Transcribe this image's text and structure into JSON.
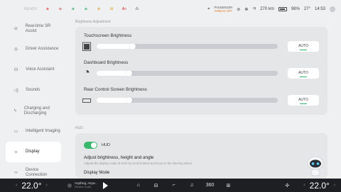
{
  "status": {
    "ready": "READY",
    "indicators": [
      {
        "name": "seatbelt-warning-icon",
        "text": "⊛",
        "color": "red"
      },
      {
        "name": "airbag-warning-icon",
        "text": "⊙",
        "color": "red"
      },
      {
        "name": "lights-icon",
        "text": "⊛",
        "color": "green"
      },
      {
        "name": "sidelights-icon",
        "text": "⊛",
        "color": "green"
      },
      {
        "name": "tire-icon",
        "text": "⊚",
        "color": "amber"
      },
      {
        "name": "engine-icon",
        "text": "⊟",
        "color": "amber"
      },
      {
        "name": "abs-icon",
        "text": "A≈",
        "color": "red"
      },
      {
        "name": "traction-icon",
        "text": "⁂",
        "color": "grey"
      }
    ],
    "airbag_label": "PASSENGER",
    "airbag_state": "AIRBAG OFF",
    "signal": "⁴ᵍ",
    "range": "270 km",
    "battery": "98%",
    "temperature": "27°",
    "time": "14:53"
  },
  "sidebar": {
    "items": [
      {
        "name": "sidebar-item-realtime-sr-assist",
        "label": "Real-time SR Assist",
        "icon": "realtime-sr-icon",
        "glyph": "⊝"
      },
      {
        "name": "sidebar-item-driver-assistance",
        "label": "Driver Assistance",
        "icon": "steering-wheel-icon",
        "glyph": "◎"
      },
      {
        "name": "sidebar-item-voice-assistant",
        "label": "Voice Assistant",
        "icon": "voice-icon",
        "glyph": "☊"
      },
      {
        "name": "sidebar-item-sounds",
        "label": "Sounds",
        "icon": "speaker-icon",
        "glyph": "◁)"
      },
      {
        "name": "sidebar-item-charging",
        "label": "Charging and Discharging",
        "icon": "charging-icon",
        "glyph": "ϟ"
      },
      {
        "name": "sidebar-item-intelligent-imaging",
        "label": "Intelligent Imaging",
        "icon": "camera-icon",
        "glyph": "▭"
      },
      {
        "name": "sidebar-item-display",
        "label": "Display",
        "icon": "brightness-icon",
        "glyph": "☼"
      },
      {
        "name": "sidebar-item-device-connection",
        "label": "Device Connection",
        "icon": "link-icon",
        "glyph": "∞"
      }
    ]
  },
  "brightness": {
    "section_title": "Brightness Adjustment",
    "sliders": [
      {
        "title": "Touchscreen Brightness",
        "value_pct": 20,
        "auto": "AUTO",
        "icon_glyph": "▣"
      },
      {
        "title": "Dashboard Brightness",
        "value_pct": 18,
        "auto": "AUTO",
        "icon_glyph": "◔"
      },
      {
        "title": "Rear Control Screen Brightness",
        "value_pct": 18,
        "auto": "AUTO",
        "icon_glyph": "▭"
      }
    ]
  },
  "hud": {
    "section_title": "HUD",
    "toggle_label": "HUD",
    "enabled": true,
    "adjust_title": "Adjust brightness, height and angle",
    "adjust_desc": "Adjusts the display mode of HUD by scroll buttons and keys on the steering wheel",
    "display_mode": "Display Mode"
  },
  "bottom": {
    "temp_left": "22.0°",
    "temp_right": "22.0°",
    "song_title": "Anything, Anyw...",
    "song_artist": "Random Audio",
    "dock_360": "360"
  }
}
